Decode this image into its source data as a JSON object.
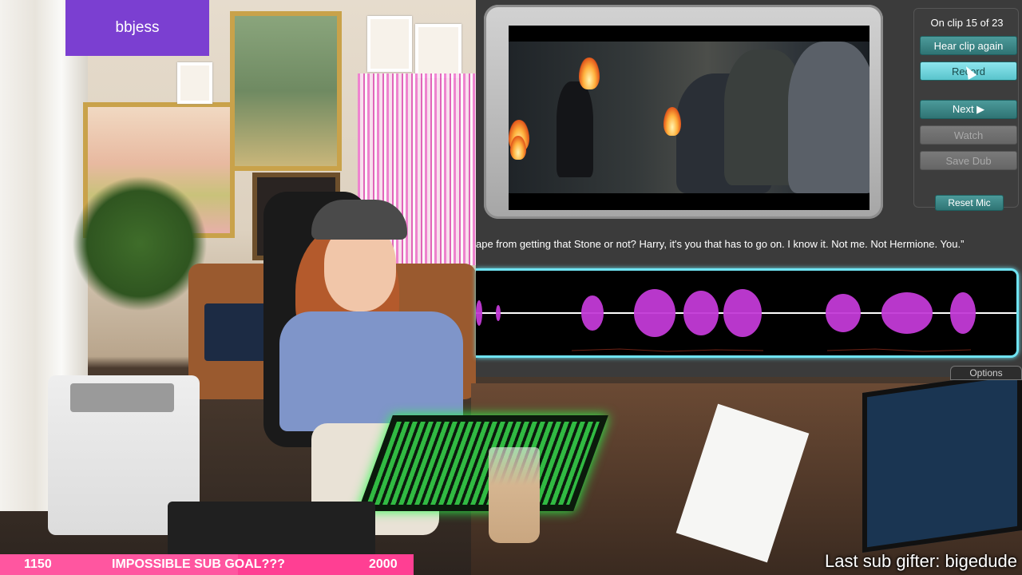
{
  "overlay": {
    "channel_sign": "bbjess",
    "sub_goal": {
      "current": "1150",
      "title": "IMPOSSIBLE SUB GOAL???",
      "target": "2000",
      "progress": 0.575,
      "color": "#ff3f93"
    },
    "last_sub_gifter": "Last sub gifter: bigedude"
  },
  "game": {
    "clip_status": "On clip 15 of 23",
    "buttons": {
      "hear_clip_again": "Hear clip again",
      "record": "Record",
      "next": "Next ▶",
      "watch": "Watch",
      "save_dub": "Save Dub",
      "reset_mic": "Reset Mic"
    },
    "subtitle": "ape from getting that Stone or not? Harry, it's you that has to go on. I know it. Not me. Not Hermione. You.”",
    "options_tab": "Options",
    "colors": {
      "accent": "#6fe3f2",
      "button": "#3e8a8a",
      "waveform": "#c23ad6"
    }
  }
}
